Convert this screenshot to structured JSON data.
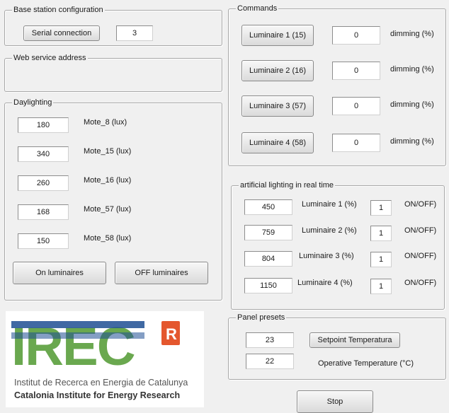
{
  "base_station": {
    "title": "Base station configuration",
    "serial_button": "Serial connection",
    "serial_value": "3"
  },
  "web_service": {
    "title": "Web service address"
  },
  "daylighting": {
    "title": "Daylighting",
    "motes": [
      {
        "value": "180",
        "label": "Mote_8 (lux)"
      },
      {
        "value": "340",
        "label": "Mote_15 (lux)"
      },
      {
        "value": "260",
        "label": "Mote_16 (lux)"
      },
      {
        "value": "168",
        "label": "Mote_57 (lux)"
      },
      {
        "value": "150",
        "label": "Mote_58 (lux)"
      }
    ],
    "on_button": "On luminaires",
    "off_button": "OFF luminaires"
  },
  "commands": {
    "title": "Commands",
    "rows": [
      {
        "button": "Luminaire 1 (15)",
        "value": "0",
        "label": "dimming (%)"
      },
      {
        "button": "Luminaire 2 (16)",
        "value": "0",
        "label": "dimming (%)"
      },
      {
        "button": "Luminaire 3 (57)",
        "value": "0",
        "label": "dimming (%)"
      },
      {
        "button": "Luminaire 4 (58)",
        "value": "0",
        "label": "dimming (%)"
      }
    ]
  },
  "artificial": {
    "title": "artificial lighting in real time",
    "rows": [
      {
        "value": "450",
        "label": "Luminaire 1 (%)",
        "state": "1",
        "state_label": "ON/OFF)"
      },
      {
        "value": "759",
        "label": "Luminaire 2 (%)",
        "state": "1",
        "state_label": "ON/OFF)"
      },
      {
        "value": "804",
        "label": "Luminaire 3 (%)",
        "state": "1",
        "state_label": "ON/OFF)"
      },
      {
        "value": "1150",
        "label": "Luminaire 4 (%)",
        "state": "1",
        "state_label": "ON/OFF)"
      }
    ]
  },
  "panel_presets": {
    "title": "Panel presets",
    "setpoint_value": "23",
    "setpoint_button": "Setpoint Temperatura",
    "operative_value": "22",
    "operative_label": "Operative Temperature (°C)"
  },
  "stop_button": "Stop",
  "logo": {
    "name": "IREC",
    "line1": "Institut de Recerca en Energia de Catalunya",
    "line2": "Catalonia Institute for Energy Research",
    "badge": "R",
    "colors": {
      "blue": "#1f4f93",
      "green": "#6aa84f",
      "orange": "#e4572e"
    }
  }
}
